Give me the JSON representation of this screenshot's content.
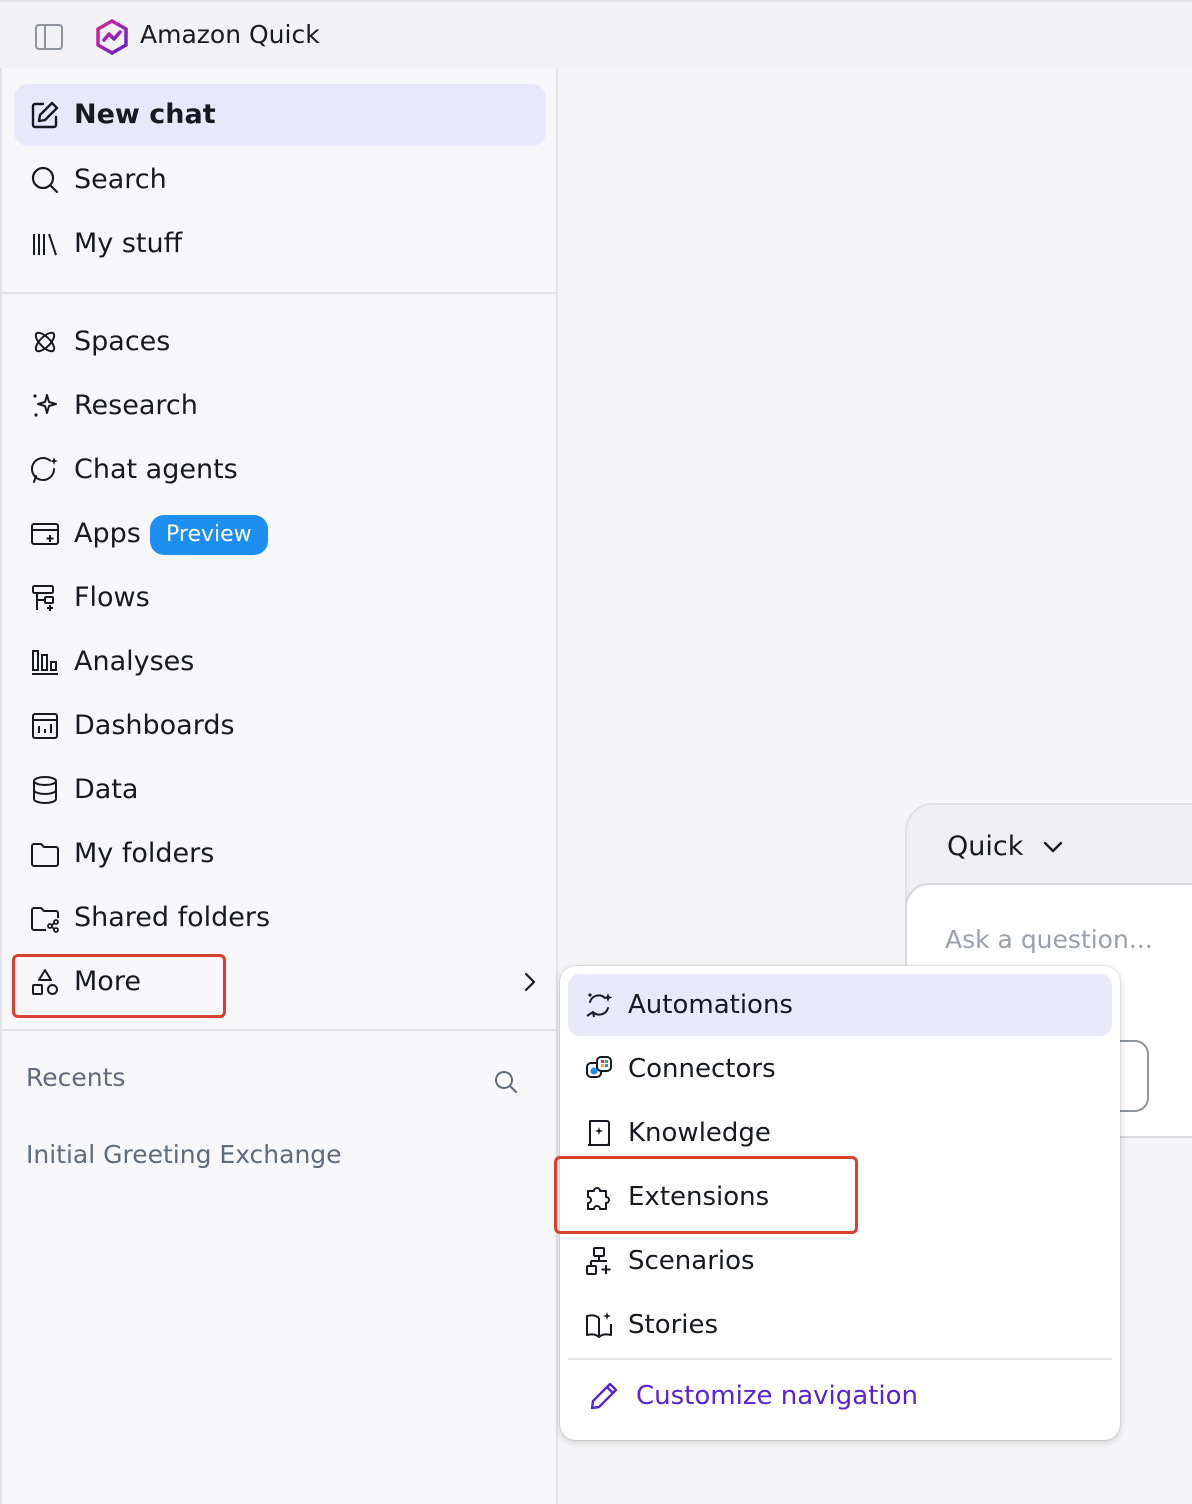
{
  "app": {
    "title": "Amazon Quick"
  },
  "sidebar": {
    "primary": [
      {
        "label": "New chat",
        "icon": "edit-icon"
      },
      {
        "label": "Search",
        "icon": "search-icon"
      },
      {
        "label": "My stuff",
        "icon": "library-icon"
      }
    ],
    "items": [
      {
        "label": "Spaces",
        "icon": "spaces-icon"
      },
      {
        "label": "Research",
        "icon": "sparkle-icon"
      },
      {
        "label": "Chat agents",
        "icon": "chat-agent-icon"
      },
      {
        "label": "Apps",
        "icon": "apps-icon",
        "badge": "Preview"
      },
      {
        "label": "Flows",
        "icon": "flows-icon"
      },
      {
        "label": "Analyses",
        "icon": "bar-chart-icon"
      },
      {
        "label": "Dashboards",
        "icon": "dashboard-icon"
      },
      {
        "label": "Data",
        "icon": "database-icon"
      },
      {
        "label": "My folders",
        "icon": "folder-icon"
      },
      {
        "label": "Shared folders",
        "icon": "shared-folder-icon"
      },
      {
        "label": "More",
        "icon": "shapes-icon"
      }
    ],
    "recents": {
      "title": "Recents",
      "items": [
        "Initial Greeting Exchange"
      ]
    }
  },
  "chat": {
    "mode": "Quick",
    "placeholder": "Ask a question..."
  },
  "more_menu": {
    "items": [
      {
        "label": "Automations",
        "icon": "automations-icon"
      },
      {
        "label": "Connectors",
        "icon": "connectors-icon"
      },
      {
        "label": "Knowledge",
        "icon": "knowledge-icon"
      },
      {
        "label": "Extensions",
        "icon": "puzzle-icon"
      },
      {
        "label": "Scenarios",
        "icon": "scenarios-icon"
      },
      {
        "label": "Stories",
        "icon": "stories-icon"
      }
    ],
    "customize_label": "Customize navigation"
  },
  "colors": {
    "accent": "#5a22d6",
    "active_bg": "#e8e8fb",
    "badge": "#1f8ef1",
    "highlight": "#d9412f"
  }
}
